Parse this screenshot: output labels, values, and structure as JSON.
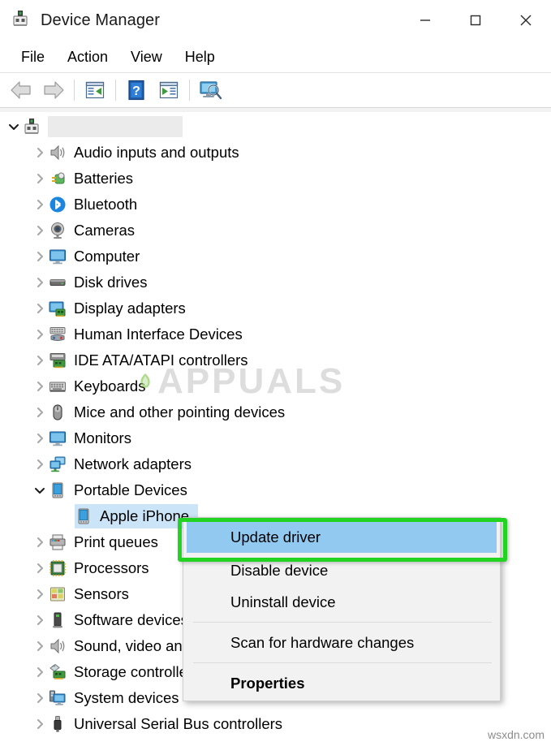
{
  "window": {
    "title": "Device Manager",
    "app_icon": "device-manager-icon",
    "controls": {
      "minimize": "minimize-icon",
      "maximize": "maximize-icon",
      "close": "close-icon"
    }
  },
  "menubar": {
    "items": [
      {
        "label": "File"
      },
      {
        "label": "Action"
      },
      {
        "label": "View"
      },
      {
        "label": "Help"
      }
    ]
  },
  "toolbar": {
    "buttons": [
      {
        "name": "back-arrow-icon",
        "tooltip": "Back"
      },
      {
        "name": "forward-arrow-icon",
        "tooltip": "Forward"
      },
      {
        "name": "properties-icon",
        "tooltip": "Properties"
      },
      {
        "name": "help-icon",
        "tooltip": "Help"
      },
      {
        "name": "scan-list-icon",
        "tooltip": "Update Driver"
      },
      {
        "name": "scan-hardware-icon",
        "tooltip": "Scan for hardware changes"
      }
    ]
  },
  "tree": {
    "root": {
      "label": "",
      "redacted": true,
      "expanded": true,
      "icon": "computer-root-icon"
    },
    "items": [
      {
        "label": "Audio inputs and outputs",
        "icon": "speaker-icon",
        "expanded": false,
        "depth": 1
      },
      {
        "label": "Batteries",
        "icon": "battery-icon",
        "expanded": false,
        "depth": 1
      },
      {
        "label": "Bluetooth",
        "icon": "bluetooth-icon",
        "expanded": false,
        "depth": 1
      },
      {
        "label": "Cameras",
        "icon": "camera-icon",
        "expanded": false,
        "depth": 1
      },
      {
        "label": "Computer",
        "icon": "monitor-icon",
        "expanded": false,
        "depth": 1
      },
      {
        "label": "Disk drives",
        "icon": "disk-drive-icon",
        "expanded": false,
        "depth": 1
      },
      {
        "label": "Display adapters",
        "icon": "display-adapter-icon",
        "expanded": false,
        "depth": 1
      },
      {
        "label": "Human Interface Devices",
        "icon": "hid-icon",
        "expanded": false,
        "depth": 1
      },
      {
        "label": "IDE ATA/ATAPI controllers",
        "icon": "ide-controller-icon",
        "expanded": false,
        "depth": 1
      },
      {
        "label": "Keyboards",
        "icon": "keyboard-icon",
        "expanded": false,
        "depth": 1
      },
      {
        "label": "Mice and other pointing devices",
        "icon": "mouse-icon",
        "expanded": false,
        "depth": 1
      },
      {
        "label": "Monitors",
        "icon": "monitor-icon",
        "expanded": false,
        "depth": 1
      },
      {
        "label": "Network adapters",
        "icon": "network-adapter-icon",
        "expanded": false,
        "depth": 1
      },
      {
        "label": "Portable Devices",
        "icon": "portable-device-icon",
        "expanded": true,
        "depth": 1
      },
      {
        "label": "Apple iPhone",
        "icon": "portable-device-icon",
        "selected": true,
        "depth": 2
      },
      {
        "label": "Print queues",
        "icon": "printer-icon",
        "expanded": false,
        "depth": 1
      },
      {
        "label": "Processors",
        "icon": "processor-icon",
        "expanded": false,
        "depth": 1
      },
      {
        "label": "Sensors",
        "icon": "sensor-icon",
        "expanded": false,
        "depth": 1
      },
      {
        "label": "Software devices",
        "icon": "software-device-icon",
        "expanded": false,
        "depth": 1
      },
      {
        "label": "Sound, video and game controllers",
        "icon": "speaker-icon",
        "expanded": false,
        "depth": 1
      },
      {
        "label": "Storage controllers",
        "icon": "storage-controller-icon",
        "expanded": false,
        "depth": 1
      },
      {
        "label": "System devices",
        "icon": "system-device-icon",
        "expanded": false,
        "depth": 1
      },
      {
        "label": "Universal Serial Bus controllers",
        "icon": "usb-icon",
        "expanded": false,
        "depth": 1
      }
    ]
  },
  "context_menu": {
    "items": [
      {
        "label": "Update driver",
        "highlighted": true,
        "bold": false
      },
      {
        "label": "Disable device",
        "highlighted": false,
        "bold": false
      },
      {
        "label": "Uninstall device",
        "highlighted": false,
        "bold": false
      },
      {
        "separator_after": true
      },
      {
        "label": "Scan for hardware changes",
        "highlighted": false,
        "bold": false
      },
      {
        "separator_after": true
      },
      {
        "label": "Properties",
        "highlighted": false,
        "bold": true
      }
    ]
  },
  "annotation": {
    "highlight_color": "#22d322",
    "target_label": "Update driver"
  },
  "watermarks": {
    "brand": "APPUALS",
    "site": "wsxdn.com"
  },
  "colors": {
    "selection_blue": "#cce4f7",
    "menu_highlight_blue": "#91c9f0",
    "menu_bg": "#f2f2f2",
    "annotation_green": "#22d322"
  }
}
